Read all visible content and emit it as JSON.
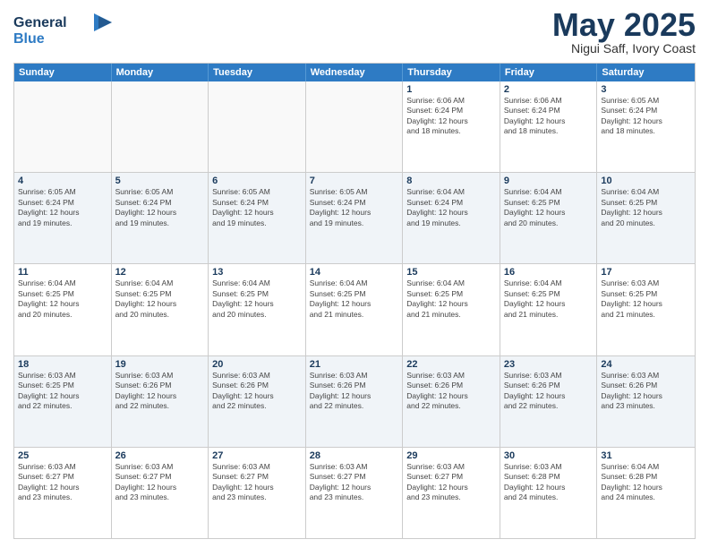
{
  "header": {
    "logo_line1": "General",
    "logo_line2": "Blue",
    "month": "May 2025",
    "location": "Nigui Saff, Ivory Coast"
  },
  "days_of_week": [
    "Sunday",
    "Monday",
    "Tuesday",
    "Wednesday",
    "Thursday",
    "Friday",
    "Saturday"
  ],
  "weeks": [
    [
      {
        "day": "",
        "info": "",
        "empty": true
      },
      {
        "day": "",
        "info": "",
        "empty": true
      },
      {
        "day": "",
        "info": "",
        "empty": true
      },
      {
        "day": "",
        "info": "",
        "empty": true
      },
      {
        "day": "1",
        "info": "Sunrise: 6:06 AM\nSunset: 6:24 PM\nDaylight: 12 hours\nand 18 minutes.",
        "empty": false
      },
      {
        "day": "2",
        "info": "Sunrise: 6:06 AM\nSunset: 6:24 PM\nDaylight: 12 hours\nand 18 minutes.",
        "empty": false
      },
      {
        "day": "3",
        "info": "Sunrise: 6:05 AM\nSunset: 6:24 PM\nDaylight: 12 hours\nand 18 minutes.",
        "empty": false
      }
    ],
    [
      {
        "day": "4",
        "info": "Sunrise: 6:05 AM\nSunset: 6:24 PM\nDaylight: 12 hours\nand 19 minutes.",
        "empty": false
      },
      {
        "day": "5",
        "info": "Sunrise: 6:05 AM\nSunset: 6:24 PM\nDaylight: 12 hours\nand 19 minutes.",
        "empty": false
      },
      {
        "day": "6",
        "info": "Sunrise: 6:05 AM\nSunset: 6:24 PM\nDaylight: 12 hours\nand 19 minutes.",
        "empty": false
      },
      {
        "day": "7",
        "info": "Sunrise: 6:05 AM\nSunset: 6:24 PM\nDaylight: 12 hours\nand 19 minutes.",
        "empty": false
      },
      {
        "day": "8",
        "info": "Sunrise: 6:04 AM\nSunset: 6:24 PM\nDaylight: 12 hours\nand 19 minutes.",
        "empty": false
      },
      {
        "day": "9",
        "info": "Sunrise: 6:04 AM\nSunset: 6:25 PM\nDaylight: 12 hours\nand 20 minutes.",
        "empty": false
      },
      {
        "day": "10",
        "info": "Sunrise: 6:04 AM\nSunset: 6:25 PM\nDaylight: 12 hours\nand 20 minutes.",
        "empty": false
      }
    ],
    [
      {
        "day": "11",
        "info": "Sunrise: 6:04 AM\nSunset: 6:25 PM\nDaylight: 12 hours\nand 20 minutes.",
        "empty": false
      },
      {
        "day": "12",
        "info": "Sunrise: 6:04 AM\nSunset: 6:25 PM\nDaylight: 12 hours\nand 20 minutes.",
        "empty": false
      },
      {
        "day": "13",
        "info": "Sunrise: 6:04 AM\nSunset: 6:25 PM\nDaylight: 12 hours\nand 20 minutes.",
        "empty": false
      },
      {
        "day": "14",
        "info": "Sunrise: 6:04 AM\nSunset: 6:25 PM\nDaylight: 12 hours\nand 21 minutes.",
        "empty": false
      },
      {
        "day": "15",
        "info": "Sunrise: 6:04 AM\nSunset: 6:25 PM\nDaylight: 12 hours\nand 21 minutes.",
        "empty": false
      },
      {
        "day": "16",
        "info": "Sunrise: 6:04 AM\nSunset: 6:25 PM\nDaylight: 12 hours\nand 21 minutes.",
        "empty": false
      },
      {
        "day": "17",
        "info": "Sunrise: 6:03 AM\nSunset: 6:25 PM\nDaylight: 12 hours\nand 21 minutes.",
        "empty": false
      }
    ],
    [
      {
        "day": "18",
        "info": "Sunrise: 6:03 AM\nSunset: 6:25 PM\nDaylight: 12 hours\nand 22 minutes.",
        "empty": false
      },
      {
        "day": "19",
        "info": "Sunrise: 6:03 AM\nSunset: 6:26 PM\nDaylight: 12 hours\nand 22 minutes.",
        "empty": false
      },
      {
        "day": "20",
        "info": "Sunrise: 6:03 AM\nSunset: 6:26 PM\nDaylight: 12 hours\nand 22 minutes.",
        "empty": false
      },
      {
        "day": "21",
        "info": "Sunrise: 6:03 AM\nSunset: 6:26 PM\nDaylight: 12 hours\nand 22 minutes.",
        "empty": false
      },
      {
        "day": "22",
        "info": "Sunrise: 6:03 AM\nSunset: 6:26 PM\nDaylight: 12 hours\nand 22 minutes.",
        "empty": false
      },
      {
        "day": "23",
        "info": "Sunrise: 6:03 AM\nSunset: 6:26 PM\nDaylight: 12 hours\nand 22 minutes.",
        "empty": false
      },
      {
        "day": "24",
        "info": "Sunrise: 6:03 AM\nSunset: 6:26 PM\nDaylight: 12 hours\nand 23 minutes.",
        "empty": false
      }
    ],
    [
      {
        "day": "25",
        "info": "Sunrise: 6:03 AM\nSunset: 6:27 PM\nDaylight: 12 hours\nand 23 minutes.",
        "empty": false
      },
      {
        "day": "26",
        "info": "Sunrise: 6:03 AM\nSunset: 6:27 PM\nDaylight: 12 hours\nand 23 minutes.",
        "empty": false
      },
      {
        "day": "27",
        "info": "Sunrise: 6:03 AM\nSunset: 6:27 PM\nDaylight: 12 hours\nand 23 minutes.",
        "empty": false
      },
      {
        "day": "28",
        "info": "Sunrise: 6:03 AM\nSunset: 6:27 PM\nDaylight: 12 hours\nand 23 minutes.",
        "empty": false
      },
      {
        "day": "29",
        "info": "Sunrise: 6:03 AM\nSunset: 6:27 PM\nDaylight: 12 hours\nand 23 minutes.",
        "empty": false
      },
      {
        "day": "30",
        "info": "Sunrise: 6:03 AM\nSunset: 6:28 PM\nDaylight: 12 hours\nand 24 minutes.",
        "empty": false
      },
      {
        "day": "31",
        "info": "Sunrise: 6:04 AM\nSunset: 6:28 PM\nDaylight: 12 hours\nand 24 minutes.",
        "empty": false
      }
    ]
  ]
}
